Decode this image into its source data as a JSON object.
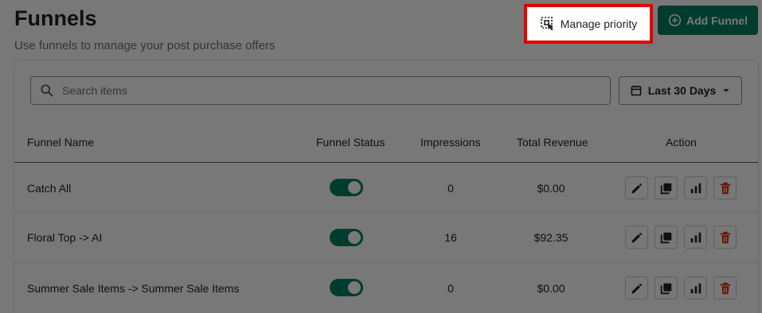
{
  "page": {
    "title": "Funnels",
    "subtitle": "Use funnels to manage your post purchase offers"
  },
  "header_actions": {
    "manage_priority_label": "Manage priority",
    "manage_priority_icon": "priority-select-icon",
    "add_funnel_label": "Add Funnel",
    "add_funnel_icon": "plus-circle-icon"
  },
  "filters": {
    "search_placeholder": "Search items",
    "search_value": "",
    "search_icon": "search-icon",
    "date_range_label": "Last 30 Days",
    "date_icon": "calendar-icon",
    "date_dropdown_icon": "caret-down-icon"
  },
  "table": {
    "columns": [
      "Funnel Name",
      "Funnel Status",
      "Impressions",
      "Total Revenue",
      "Action"
    ],
    "rows": [
      {
        "name": "Catch All",
        "status_enabled": true,
        "impressions": "0",
        "revenue": "$0.00"
      },
      {
        "name": "Floral Top -> AI",
        "status_enabled": true,
        "impressions": "16",
        "revenue": "$92.35"
      },
      {
        "name": "Summer Sale Items -> Summer Sale Items",
        "status_enabled": true,
        "impressions": "0",
        "revenue": "$0.00"
      }
    ],
    "action_icons": [
      "edit-icon",
      "duplicate-icon",
      "analytics-icon",
      "delete-icon"
    ]
  },
  "colors": {
    "primary": "#008060",
    "highlight": "#e30000",
    "delete": "#d72c0d",
    "overlay": "rgba(0,0,0,0.53)"
  }
}
